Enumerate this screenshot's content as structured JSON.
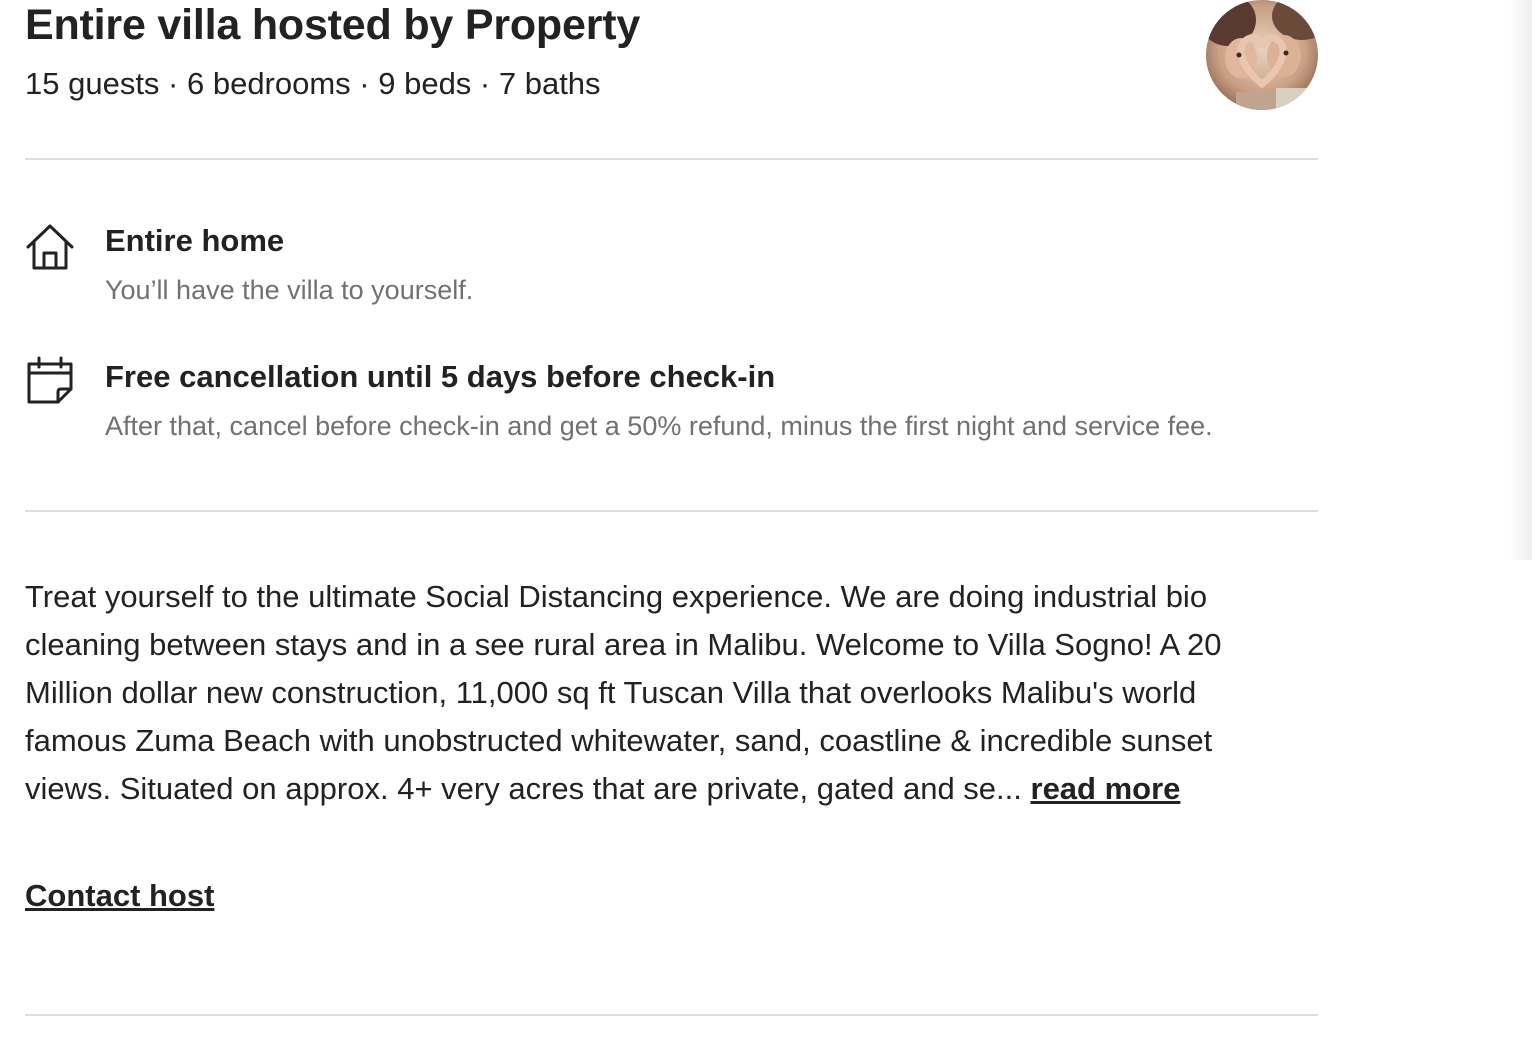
{
  "header": {
    "title": "Entire villa hosted by Property",
    "summary": "15 guests · 6 bedrooms · 9 beds · 7 baths"
  },
  "host": {
    "avatar_icon": "host-avatar"
  },
  "features": [
    {
      "icon": "house-icon",
      "title": "Entire home",
      "description": "You’ll have the villa to yourself."
    },
    {
      "icon": "calendar-icon",
      "title": "Free cancellation until 5 days before check-in",
      "description": "After that, cancel before check-in and get a 50% refund, minus the first night and service fee."
    }
  ],
  "description": {
    "lines": [
      "Treat yourself to the ultimate Social Distancing experience. We are doing industrial bio",
      "cleaning between stays and in a see rural area in Malibu. Welcome to Villa Sogno! A 20",
      "Million dollar new construction, 11,000 sq ft Tuscan Villa that overlooks Malibu's world",
      "famous Zuma Beach with unobstructed whitewater, sand, coastline & incredible sunset",
      "views. Situated on approx. 4+ very acres that are private, gated and se... "
    ],
    "read_more_label": "read more"
  },
  "contact": {
    "label": "Contact host"
  },
  "colors": {
    "text_primary": "#222222",
    "text_secondary": "#717171",
    "divider": "#dddddd"
  }
}
